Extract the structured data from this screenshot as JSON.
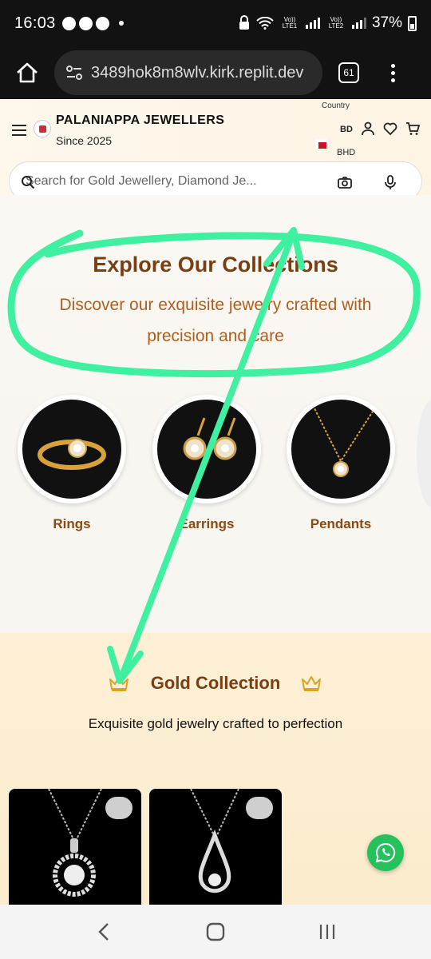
{
  "status_bar": {
    "time": "16:03",
    "battery": "37%",
    "net1": "Vo)) LTE1",
    "net2": "Vo)) LTE2"
  },
  "browser": {
    "url": "3489hok8m8wlv.kirk.replit.dev",
    "tab_count": "61"
  },
  "header": {
    "brand": "PALANIAPPA JEWELLERS",
    "since": "Since 2025",
    "country_label": "Country",
    "country_code": "BD",
    "currency": "BHD"
  },
  "search": {
    "placeholder": "Search for Gold Jewellery, Diamond Je..."
  },
  "collections": {
    "title": "Explore Our Collections",
    "subtitle": "Discover our exquisite jewelry crafted with precision and care",
    "categories": [
      {
        "label": "Rings"
      },
      {
        "label": "Earrings"
      },
      {
        "label": "Pendants"
      }
    ]
  },
  "gold": {
    "title": "Gold Collection",
    "subtitle": "Exquisite gold jewelry crafted to perfection"
  },
  "colors": {
    "accent_brown": "#7a3e13",
    "accent_orange": "#b05e1e",
    "gold_bg": "#fdf0d6",
    "annotation_green": "#3ef0a0",
    "whatsapp": "#25c15c"
  }
}
